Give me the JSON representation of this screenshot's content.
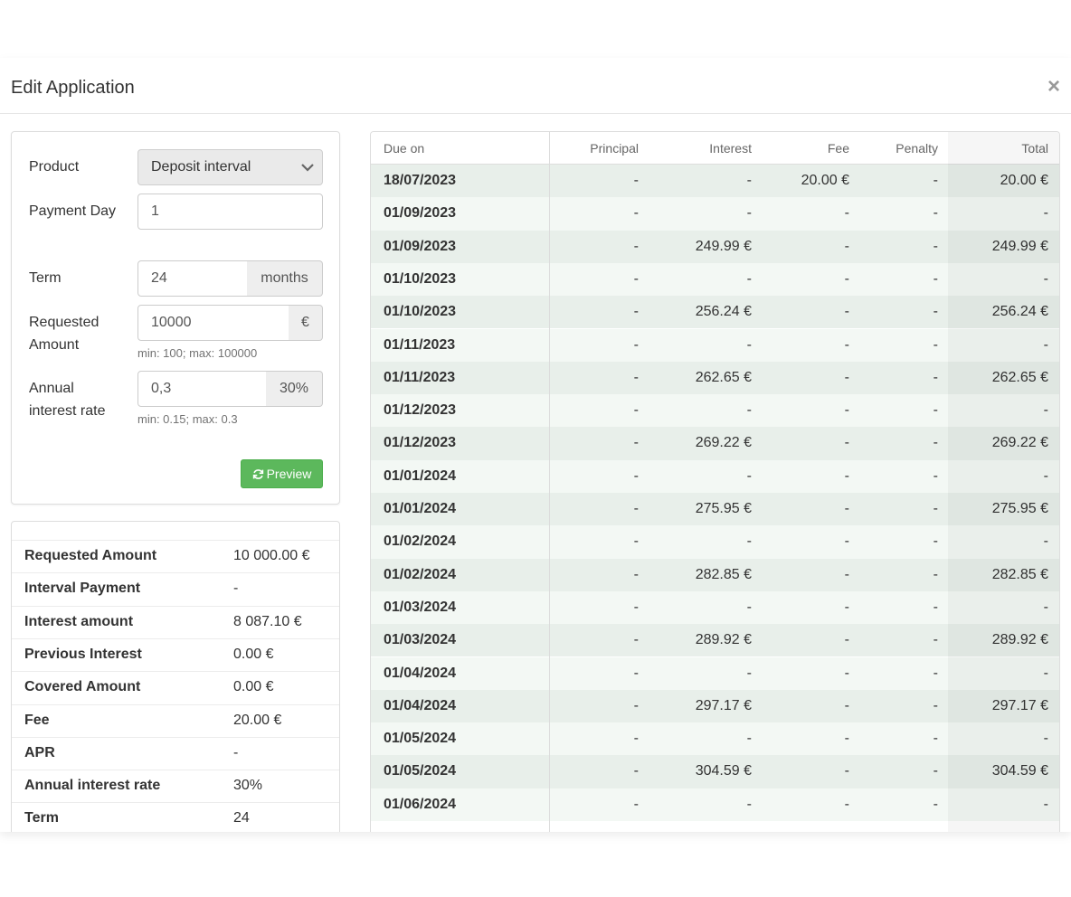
{
  "modal": {
    "title": "Edit Application",
    "close": "×"
  },
  "form": {
    "product_label": "Product",
    "product_value": "Deposit interval",
    "payment_day_label": "Payment Day",
    "payment_day_value": "1",
    "term_label": "Term",
    "term_value": "24",
    "term_unit": "months",
    "amount_label": "Requested Amount",
    "amount_value": "10000",
    "amount_unit": "€",
    "amount_help": "min: 100; max: 100000",
    "rate_label": "Annual interest rate",
    "rate_value": "0,3",
    "rate_unit": "30%",
    "rate_help": "min: 0.15; max: 0.3",
    "preview_button": "Preview"
  },
  "summary": [
    {
      "key": "Requested Amount",
      "value": "10 000.00 €"
    },
    {
      "key": "Interval Payment",
      "value": "-"
    },
    {
      "key": "Interest amount",
      "value": "8 087.10 €"
    },
    {
      "key": "Previous Interest",
      "value": "0.00 €"
    },
    {
      "key": "Covered Amount",
      "value": "0.00 €"
    },
    {
      "key": "Fee",
      "value": "20.00 €"
    },
    {
      "key": "APR",
      "value": "-"
    },
    {
      "key": "Annual interest rate",
      "value": "30%"
    },
    {
      "key": "Term",
      "value": "24"
    }
  ],
  "schedule": {
    "columns": [
      "Due on",
      "Principal",
      "Interest",
      "Fee",
      "Penalty",
      "Total"
    ],
    "rows": [
      [
        "18/07/2023",
        "-",
        "-",
        "20.00 €",
        "-",
        "20.00 €"
      ],
      [
        "01/09/2023",
        "-",
        "-",
        "-",
        "-",
        "-"
      ],
      [
        "01/09/2023",
        "-",
        "249.99 €",
        "-",
        "-",
        "249.99 €"
      ],
      [
        "01/10/2023",
        "-",
        "-",
        "-",
        "-",
        "-"
      ],
      [
        "01/10/2023",
        "-",
        "256.24 €",
        "-",
        "-",
        "256.24 €"
      ],
      [
        "01/11/2023",
        "-",
        "-",
        "-",
        "-",
        "-"
      ],
      [
        "01/11/2023",
        "-",
        "262.65 €",
        "-",
        "-",
        "262.65 €"
      ],
      [
        "01/12/2023",
        "-",
        "-",
        "-",
        "-",
        "-"
      ],
      [
        "01/12/2023",
        "-",
        "269.22 €",
        "-",
        "-",
        "269.22 €"
      ],
      [
        "01/01/2024",
        "-",
        "-",
        "-",
        "-",
        "-"
      ],
      [
        "01/01/2024",
        "-",
        "275.95 €",
        "-",
        "-",
        "275.95 €"
      ],
      [
        "01/02/2024",
        "-",
        "-",
        "-",
        "-",
        "-"
      ],
      [
        "01/02/2024",
        "-",
        "282.85 €",
        "-",
        "-",
        "282.85 €"
      ],
      [
        "01/03/2024",
        "-",
        "-",
        "-",
        "-",
        "-"
      ],
      [
        "01/03/2024",
        "-",
        "289.92 €",
        "-",
        "-",
        "289.92 €"
      ],
      [
        "01/04/2024",
        "-",
        "-",
        "-",
        "-",
        "-"
      ],
      [
        "01/04/2024",
        "-",
        "297.17 €",
        "-",
        "-",
        "297.17 €"
      ],
      [
        "01/05/2024",
        "-",
        "-",
        "-",
        "-",
        "-"
      ],
      [
        "01/05/2024",
        "-",
        "304.59 €",
        "-",
        "-",
        "304.59 €"
      ],
      [
        "01/06/2024",
        "-",
        "-",
        "-",
        "-",
        "-"
      ]
    ]
  },
  "colors": {
    "success": "#5cb85c",
    "row_odd": "#e8efea",
    "row_even": "#f3f8f4"
  }
}
